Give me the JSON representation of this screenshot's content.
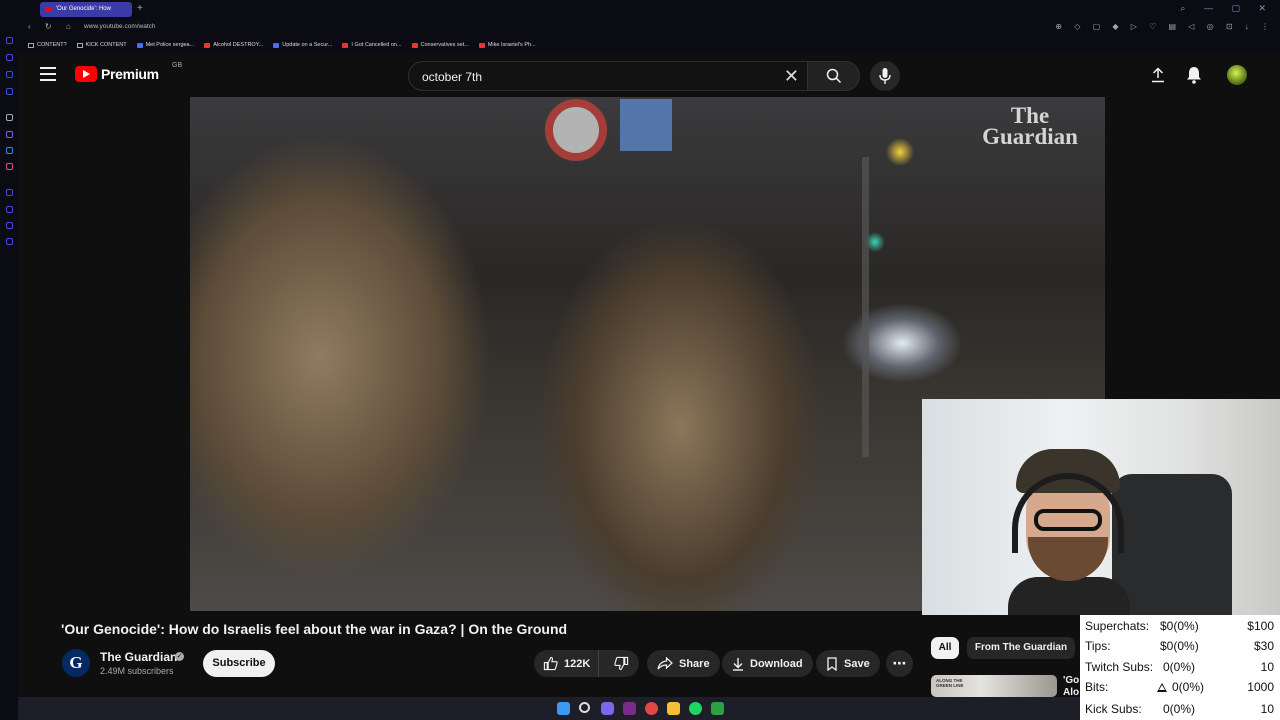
{
  "browser": {
    "active_tab_title": "'Our Genocide': How",
    "url": "www.youtube.com/watch",
    "bookmarks": [
      {
        "label": "CONTENT?",
        "kind": "folder"
      },
      {
        "label": "KICK CONTENT",
        "kind": "folder"
      },
      {
        "label": "Met Police sergea...",
        "kind": "site"
      },
      {
        "label": "Alcohol DESTROY...",
        "kind": "youtube"
      },
      {
        "label": "Update on a Secur...",
        "kind": "site"
      },
      {
        "label": "I Got Cancelled on...",
        "kind": "youtube"
      },
      {
        "label": "Conservatives set...",
        "kind": "youtube"
      },
      {
        "label": "Mike Israetel's Ph...",
        "kind": "youtube"
      }
    ]
  },
  "masthead": {
    "logo_text": "Premium",
    "region": "GB",
    "search_value": "october 7th"
  },
  "video": {
    "watermark": "The Guardian",
    "title": "'Our Genocide': How do Israelis feel about the war in Gaza? | On the Ground"
  },
  "channel": {
    "avatar_letter": "G",
    "name": "The Guardian",
    "subscribers": "2.49M subscribers",
    "subscribe_label": "Subscribe"
  },
  "actions": {
    "like_count": "122K",
    "share_label": "Share",
    "download_label": "Download",
    "save_label": "Save",
    "more_label": "⋯"
  },
  "sidebar": {
    "chips": [
      "All",
      "From The Guardian"
    ],
    "rec_thumb_text": "ALONG THE GREEN LINE",
    "rec_title_line1": "'Go",
    "rec_title_line2": "Alo"
  },
  "stats": [
    {
      "label": "Superchats:",
      "value": "$0(0%)",
      "goal": "$100"
    },
    {
      "label": "Tips:",
      "value": "$0(0%)",
      "goal": "$30"
    },
    {
      "label": "Twitch Subs:",
      "value": "0(0%)",
      "goal": "10"
    },
    {
      "label": "Bits:",
      "value": "0(0%)",
      "goal": "1000"
    },
    {
      "label": "Kick Subs:",
      "value": "0(0%)",
      "goal": "10"
    }
  ],
  "colors": {
    "accent_red": "#ff0000",
    "background": "#0f0f0f",
    "pill": "#272727",
    "browser_tab": "#3a3aa8"
  }
}
